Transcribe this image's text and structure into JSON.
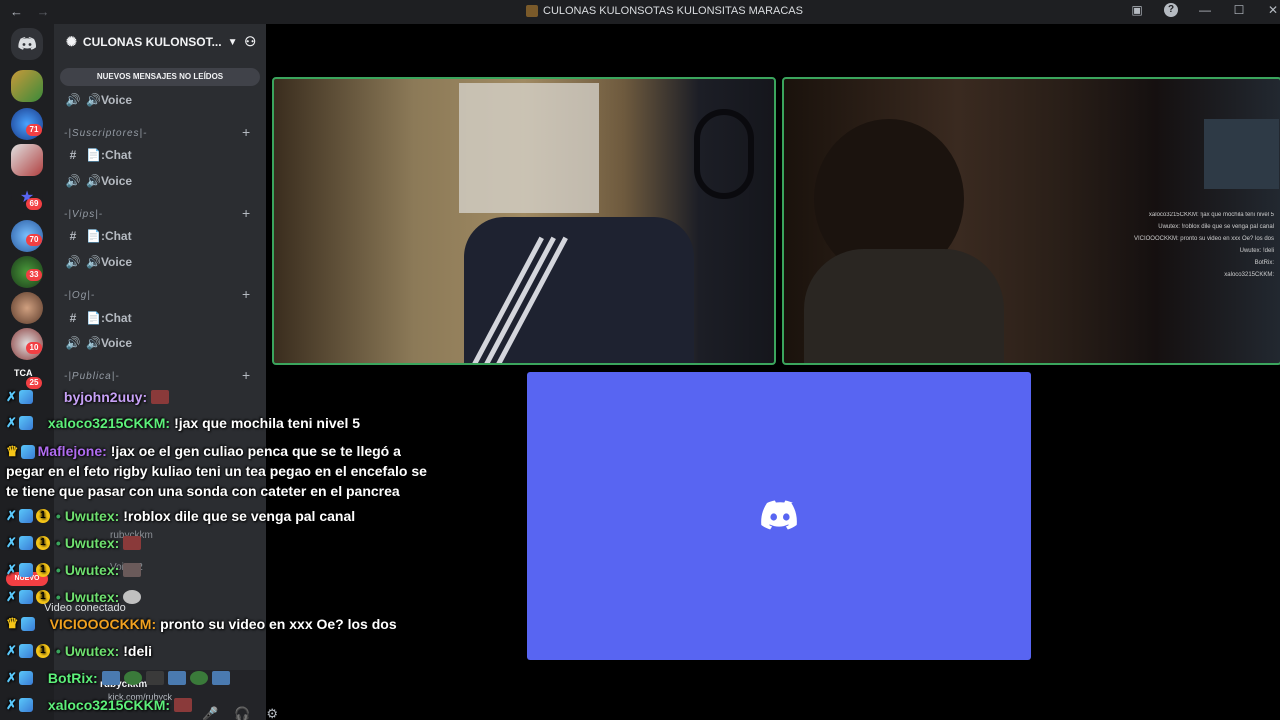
{
  "titlebar": {
    "back": "←",
    "forward": "→",
    "title": "CULONAS KULONSOTAS KULONSITAS MARACAS",
    "icons": [
      "screen-record-icon",
      "help-icon",
      "minimize-icon",
      "maximize-icon",
      "close-icon"
    ],
    "help_glyph": "?",
    "minimize_glyph": "—",
    "maximize_glyph": "☐",
    "close_glyph": "✕"
  },
  "rail": {
    "badges": [
      "71",
      "69",
      "70",
      "33",
      "10",
      "25"
    ],
    "new_label": "NUEVO",
    "tca_label": "TCA"
  },
  "sidebar": {
    "server_name": "CULONAS KULONSOT...",
    "unread_pill": "NUEVOS MENSAJES NO LEÍDOS",
    "channels": [
      {
        "type": "voice",
        "label": "🔊Voice"
      },
      {
        "type": "category",
        "label": "-|Suscriptores|-"
      },
      {
        "type": "text",
        "label": "📄:Chat"
      },
      {
        "type": "voice",
        "label": "🔊Voice"
      },
      {
        "type": "category",
        "label": "-|Vips|-"
      },
      {
        "type": "text",
        "label": "📄:Chat"
      },
      {
        "type": "voice",
        "label": "🔊Voice"
      },
      {
        "type": "category",
        "label": "-|Og|-"
      },
      {
        "type": "text",
        "label": "📄:Chat"
      },
      {
        "type": "voice",
        "label": "🔊Voice"
      },
      {
        "type": "category",
        "label": "-|Publica|-"
      }
    ],
    "ghost_items": [
      "rubyckkm",
      "Voice 2"
    ],
    "voice_status": "Video conectado",
    "user_name": "rubyckkm",
    "user_sub": "kick.com/rubyck"
  },
  "video_chat": [
    "xaloco3215CKKM: !jax que mochila teni nivel 5",
    "Uwutex: !roblox dile que se venga pal canal",
    "VICIOOOCKKM: pronto su video en xxx Oe? los dos",
    "Uwutex: !deli",
    "BotRix:",
    "xaloco3215CKKM:"
  ],
  "chat": [
    {
      "user": "byjohn2uuy:",
      "text": "",
      "color": "lilac",
      "badges": [
        "sword",
        "sub"
      ]
    },
    {
      "user": "xaloco3215CKKM:",
      "text": "!jax que mochila teni nivel 5",
      "color": "green",
      "badges": [
        "sword",
        "sub"
      ]
    },
    {
      "user": "Maflejone:",
      "text": "!jax oe el gen culiao penca que se te llegó a pegar en el feto rigby kuliao teni un tea pegao en el encefalo se te tiene que pasar con una sonda con cateter en el pancrea",
      "color": "purple",
      "badges": [
        "crown",
        "sub"
      ]
    },
    {
      "user": "Uwutex:",
      "text": "!roblox dile que se venga pal canal",
      "color": "lgreen",
      "badges": [
        "sword",
        "sub",
        "one"
      ]
    },
    {
      "user": "Uwutex:",
      "text": "",
      "color": "lgreen",
      "badges": [
        "sword",
        "sub",
        "one"
      ]
    },
    {
      "user": "Uwutex:",
      "text": "",
      "color": "lgreen",
      "badges": [
        "sword",
        "sub",
        "one"
      ]
    },
    {
      "user": "Uwutex:",
      "text": "",
      "color": "lgreen",
      "badges": [
        "sword",
        "sub",
        "one"
      ]
    },
    {
      "user": "VICIOOOCKKM:",
      "text": "pronto su video en xxx Oe? los dos",
      "color": "orange",
      "badges": [
        "crown",
        "sub"
      ]
    },
    {
      "user": "Uwutex:",
      "text": "!deli",
      "color": "lgreen",
      "badges": [
        "sword",
        "sub",
        "one"
      ]
    },
    {
      "user": "BotRix:",
      "text": "",
      "color": "green",
      "badges": [
        "sword",
        "sub"
      ]
    },
    {
      "user": "xaloco3215CKKM:",
      "text": "",
      "color": "green",
      "badges": [
        "sword",
        "sub"
      ]
    }
  ],
  "colors": {
    "accent": "#5865f2",
    "speaking": "#3ba55d",
    "badge": "#f23f43"
  }
}
